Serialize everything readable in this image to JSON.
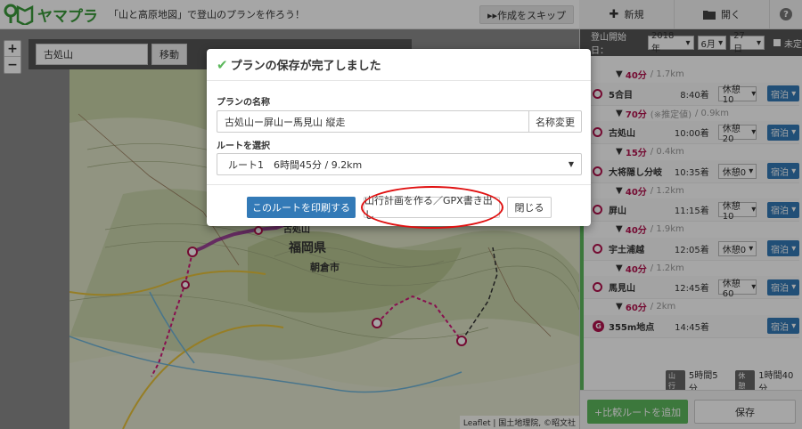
{
  "header": {
    "logo_text": "ヤマプラ",
    "tagline": "「山と高原地図」で登山のプランを作ろう！",
    "skip_label": "▸▸作成をスキップ"
  },
  "right_header": {
    "new_label": "新規",
    "open_label": "開く",
    "help": "?"
  },
  "map": {
    "search_value": "古処山",
    "move_label": "移動",
    "zoom_in": "+",
    "zoom_out": "−",
    "attribution": "Leaflet | 国土地理院, ©昭文社",
    "labels": {
      "prefecture": "福岡県",
      "city": "朝倉市",
      "peak": "古処山"
    }
  },
  "panel": {
    "start_date_label": "登山開始日：",
    "year": "2018年",
    "month": "6月",
    "day": "27日",
    "undecided": "未定",
    "stops": [
      {
        "name": "5合目",
        "time": "8:40着",
        "rest": "休憩10",
        "stay": "宿泊"
      },
      {
        "name": "古処山",
        "time": "10:00着",
        "rest": "休憩20",
        "stay": "宿泊"
      },
      {
        "name": "大将隠し分岐",
        "time": "10:35着",
        "rest": "休憩0",
        "stay": "宿泊"
      },
      {
        "name": "屏山",
        "time": "11:15着",
        "rest": "休憩10",
        "stay": "宿泊"
      },
      {
        "name": "宇土浦越",
        "time": "12:05着",
        "rest": "休憩0",
        "stay": "宿泊"
      },
      {
        "name": "馬見山",
        "time": "12:45着",
        "rest": "休憩60",
        "stay": "宿泊"
      },
      {
        "name": "355m地点",
        "time": "14:45着",
        "rest": "",
        "stay": "宿泊"
      }
    ],
    "segments": [
      {
        "dur": "40分",
        "dist": "/ 1.7km"
      },
      {
        "dur": "70分",
        "note": "(※推定値)",
        "dist": "/ 0.9km"
      },
      {
        "dur": "15分",
        "dist": "/ 0.4km"
      },
      {
        "dur": "40分",
        "dist": "/ 1.2km"
      },
      {
        "dur": "40分",
        "dist": "/ 1.9km"
      },
      {
        "dur": "40分",
        "dist": "/ 1.2km"
      },
      {
        "dur": "60分",
        "dist": "/ 2km"
      }
    ],
    "goal_marker": "G",
    "total_walk_badge": "山行",
    "total_walk": "5時間5分",
    "total_rest_badge": "休憩",
    "total_rest": "1時間40分",
    "add_compare_label": "+比較ルートを追加",
    "save_label": "保存"
  },
  "modal": {
    "title": "プランの保存が完了しました",
    "name_label": "プランの名称",
    "name_value": "古処山ー屏山ー馬見山 縦走",
    "rename_label": "名称変更",
    "route_label": "ルートを選択",
    "route_value": "ルート1　6時間45分 / 9.2km",
    "print_label": "このルートを印刷する",
    "gpx_label": "山行計画を作る／GPX書き出し",
    "close_label": "閉じる"
  },
  "colors": {
    "accent_green": "#5cb85c",
    "primary_blue": "#337ab7",
    "route_purple": "#b3124d",
    "highlight_red": "#e01010"
  }
}
